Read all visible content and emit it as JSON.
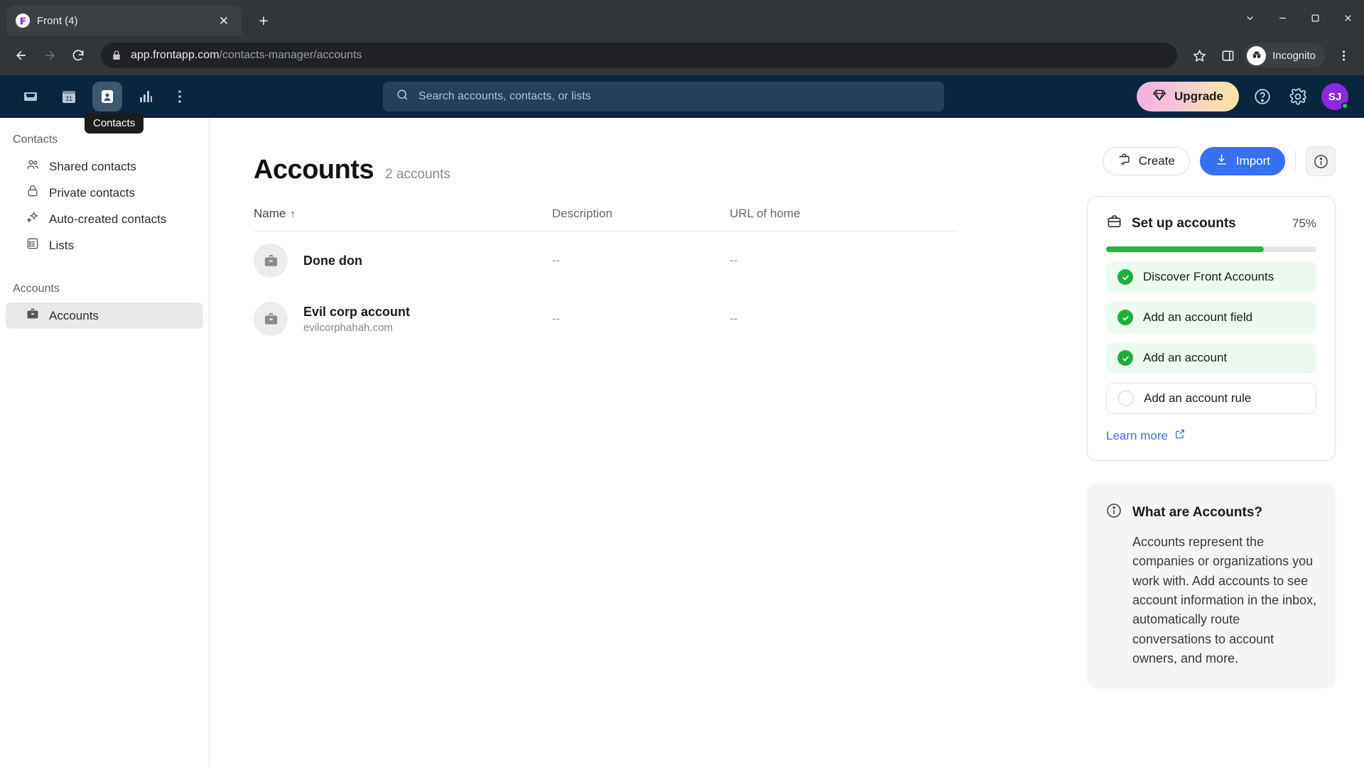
{
  "browser": {
    "tab": {
      "title": "Front (4)",
      "favicon_icon": "front-logo-icon",
      "close_icon": "close-icon"
    },
    "new_tab_icon": "plus-icon",
    "window_controls": {
      "minimize_icon": "chevron-down-icon",
      "dash_icon": "minimize-icon",
      "maximize_icon": "maximize-icon",
      "close_icon": "close-icon"
    },
    "nav": {
      "back_icon": "arrow-left-icon",
      "forward_icon": "arrow-right-icon",
      "reload_icon": "reload-icon"
    },
    "address": {
      "lock_icon": "lock-icon",
      "domain": "app.frontapp.com",
      "path": "/contacts-manager/accounts"
    },
    "bookmark_icon": "star-icon",
    "side_panel_icon": "side-panel-icon",
    "incognito_label": "Incognito",
    "incognito_icon": "incognito-icon",
    "menu_icon": "kebab-menu-icon"
  },
  "topnav": {
    "icons": [
      {
        "name": "inbox-icon",
        "label": "Inbox",
        "active": false
      },
      {
        "name": "calendar-icon",
        "label": "Calendar",
        "day": "31",
        "active": false
      },
      {
        "name": "contacts-icon",
        "label": "Contacts",
        "active": true
      },
      {
        "name": "analytics-icon",
        "label": "Analytics",
        "active": false
      },
      {
        "name": "more-icon",
        "label": "More",
        "active": false
      }
    ],
    "tooltip": "Contacts",
    "search_placeholder": "Search accounts, contacts, or lists",
    "search_icon": "search-icon",
    "upgrade_label": "Upgrade",
    "upgrade_icon": "diamond-icon",
    "help_icon": "help-icon",
    "settings_icon": "gear-icon",
    "avatar_initials": "SJ",
    "avatar_color": "#8b2ae0",
    "status_color": "#22c55e"
  },
  "sidebar": {
    "sections": [
      {
        "header": "Contacts",
        "items": [
          {
            "label": "Shared contacts",
            "icon": "people-icon",
            "active": false
          },
          {
            "label": "Private contacts",
            "icon": "lock-icon",
            "active": false
          },
          {
            "label": "Auto-created contacts",
            "icon": "sparkle-icon",
            "active": false
          },
          {
            "label": "Lists",
            "icon": "list-icon",
            "active": false
          }
        ]
      },
      {
        "header": "Accounts",
        "items": [
          {
            "label": "Accounts",
            "icon": "briefcase-icon",
            "active": true
          }
        ]
      }
    ]
  },
  "main": {
    "title": "Accounts",
    "subtitle": "2 accounts",
    "columns": [
      {
        "label": "Name",
        "sort": "↑"
      },
      {
        "label": "Description",
        "sort": ""
      },
      {
        "label": "URL of home",
        "sort": ""
      }
    ],
    "rows": [
      {
        "name": "Done don",
        "sub": "",
        "description": "--",
        "url": "--",
        "icon": "briefcase-icon"
      },
      {
        "name": "Evil corp account",
        "sub": "evilcorphahah.com",
        "description": "--",
        "url": "--",
        "icon": "briefcase-icon"
      }
    ]
  },
  "rail": {
    "create_label": "Create",
    "create_icon": "briefcase-plus-icon",
    "import_label": "Import",
    "import_icon": "download-icon",
    "info_icon": "info-icon",
    "setup": {
      "title": "Set up accounts",
      "icon": "briefcase-icon",
      "percent_label": "75%",
      "percent_value": 75,
      "progress_color": "#22b53f",
      "items": [
        {
          "label": "Discover Front Accounts",
          "done": true
        },
        {
          "label": "Add an account field",
          "done": true
        },
        {
          "label": "Add an account",
          "done": true
        },
        {
          "label": "Add an account rule",
          "done": false
        }
      ],
      "learn_more_label": "Learn more",
      "learn_more_icon": "external-link-icon"
    },
    "about": {
      "icon": "info-icon",
      "title": "What are Accounts?",
      "body": "Accounts represent the companies or organizations you work with. Add accounts to see account information in the inbox, automatically route conversations to account owners, and more."
    }
  }
}
